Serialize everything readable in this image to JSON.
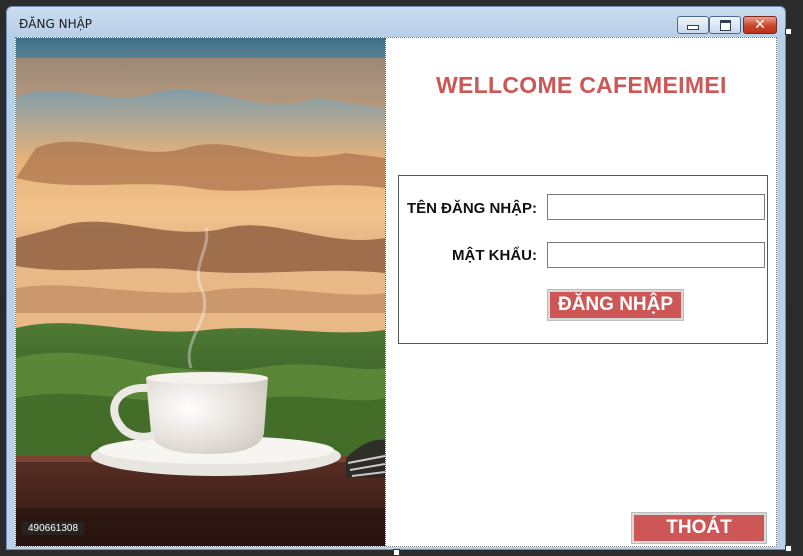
{
  "window": {
    "title": "ĐĂNG NHẬP",
    "controls": {
      "minimize_icon": "minimize-icon",
      "maximize_icon": "maximize-icon",
      "close_icon": "close-icon",
      "close_glyph": "✕"
    }
  },
  "photo": {
    "description_icon": "coffee-cup-landscape-photo",
    "stock_id": "490661308"
  },
  "welcome_text": "WELLCOME CAFEMEIMEI",
  "login": {
    "username_label": "TÊN ĐĂNG NHẬP:",
    "username_value": "",
    "password_label": "MẬT KHẨU:",
    "password_value": "",
    "login_button": "ĐĂNG NHẬP"
  },
  "exit_button": "THOÁT",
  "colors": {
    "accent": "#cd5757",
    "titlebar": "#bcd2ea"
  }
}
